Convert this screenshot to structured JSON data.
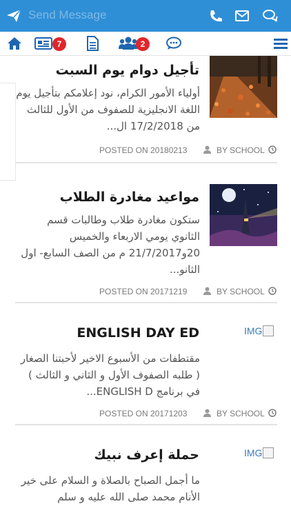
{
  "topbar": {
    "placeholder": "Send Message",
    "icons": [
      "send-icon",
      "phone-icon",
      "mail-icon",
      "chat-bubbles-icon"
    ]
  },
  "nav": {
    "icons": [
      "home-icon",
      "news-icon",
      "document-icon",
      "users-icon",
      "message-icon",
      "menu-icon"
    ],
    "news_badge": "7",
    "users_badge": "2"
  },
  "posts": [
    {
      "title": "تأجيل دوام يوم السبت",
      "body": "أولياء الأمور الكرام، نود إعلامكم بتأجيل يوم اللغة الانجليزية للصفوف من الأول للثالث من 17/2/2018 ال...",
      "posted": "POSTED ON 20180213",
      "author": "BY SCHOOL"
    },
    {
      "title": "مواعيد مغادرة الطلاب",
      "body": "ستكون مغادرة طلاب وطالبات قسم الثانوي يومي الاربعاء والخميس 20و21/7/2017 م من الصف السابع- اول الثانو...",
      "posted": "POSTED ON 20171219",
      "author": "BY SCHOOL"
    },
    {
      "title": "ENGLISH DAY ED",
      "image_alt": "IMG",
      "body": "مقتطفات من الأسبوع الاخير لأحبتنا الصغار ( طلبه الصفوف الأول و الثاني و الثالث ) في برنامج ENGLISH D...",
      "posted": "POSTED ON 20171203",
      "author": "BY SCHOOL"
    },
    {
      "title": "حملة إعرف نبيك",
      "image_alt": "IMG",
      "body": "ما أجمل الصباح بالصلاة و السلام على خير الأنام محمد صلى الله عليه و سلم"
    }
  ],
  "colors": {
    "topbar": "#2f8fd6",
    "nav_icon": "#1f66b0",
    "badge": "#e0262b"
  }
}
